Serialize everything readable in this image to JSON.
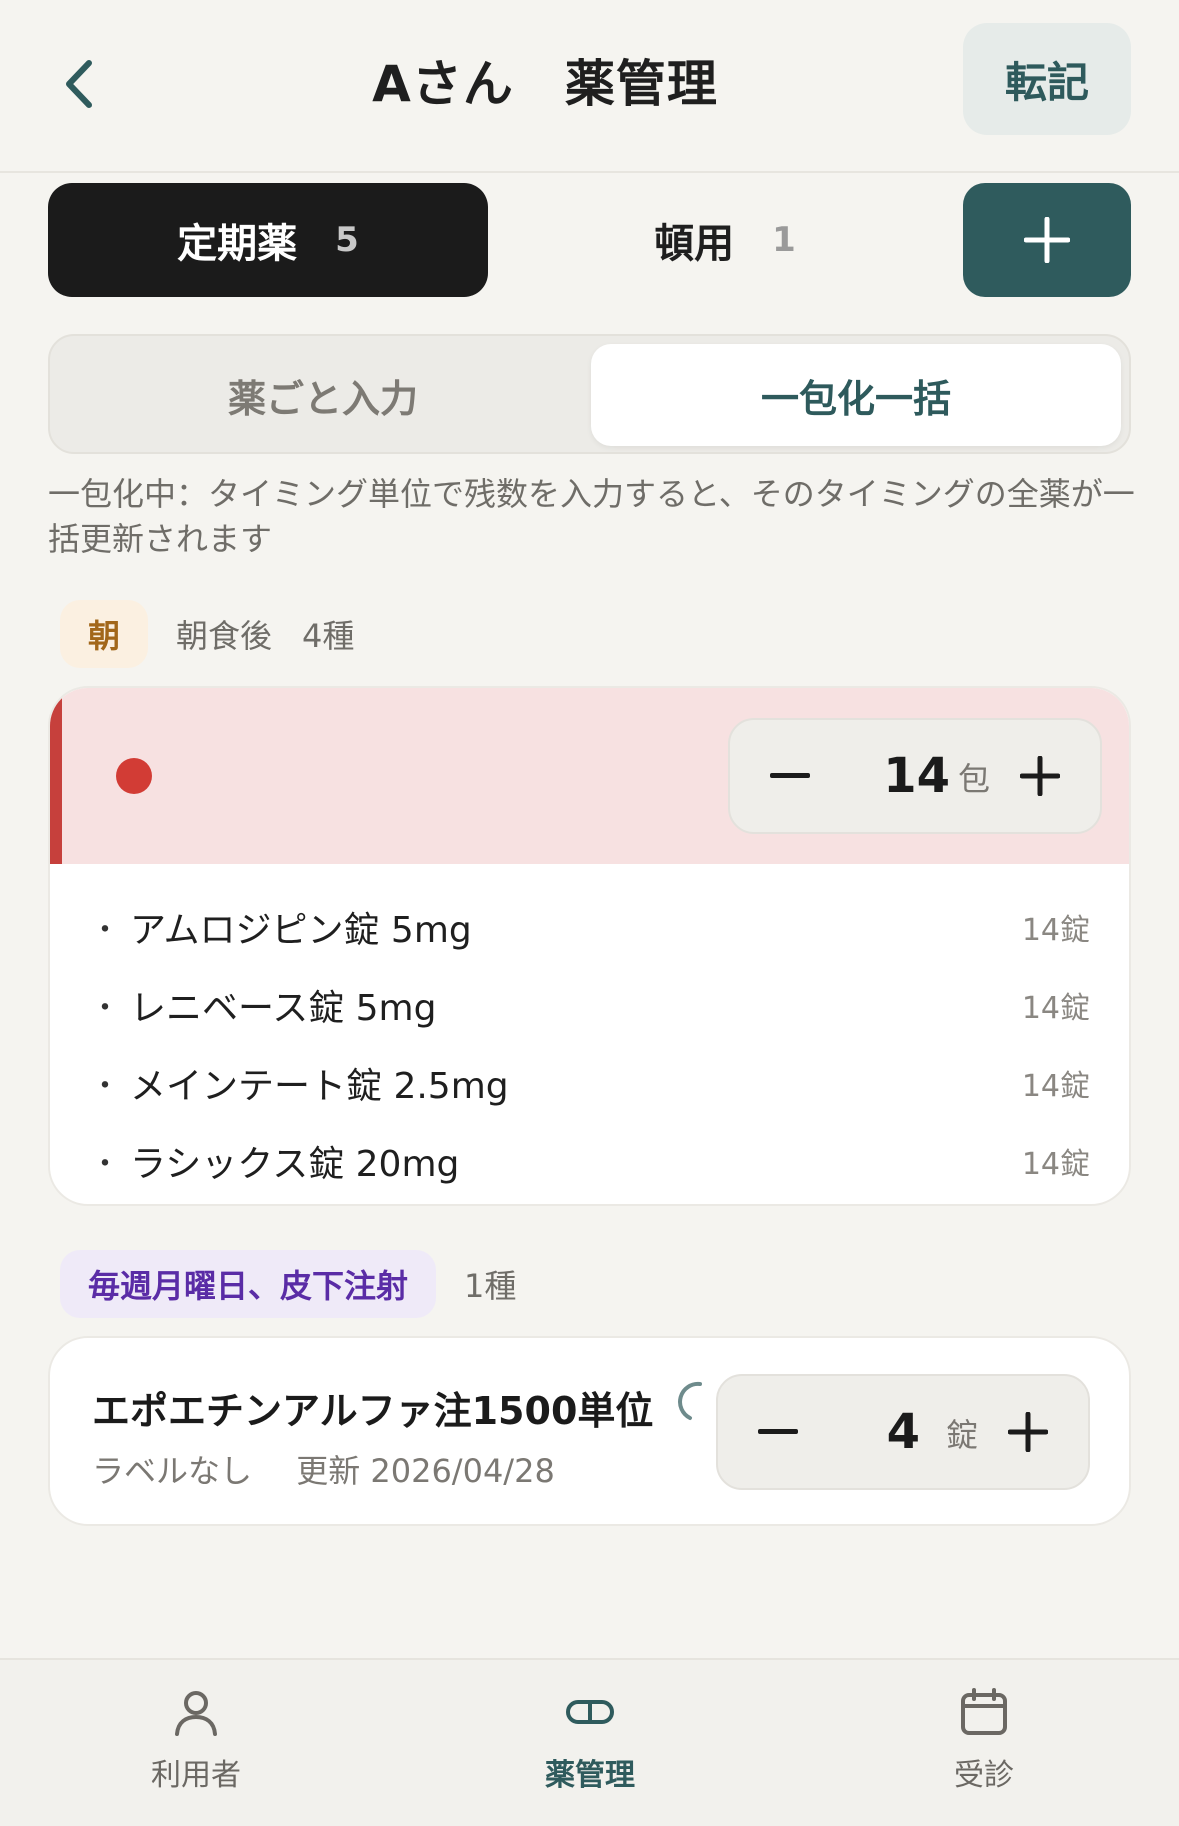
{
  "header": {
    "title": "Aさん　薬管理",
    "transcribe_label": "転記"
  },
  "category_tabs": [
    {
      "label": "定期薬",
      "count": "5",
      "active": true
    },
    {
      "label": "頓用",
      "count": "1",
      "active": false
    }
  ],
  "mode_segment": {
    "left_label": "薬ごと入力",
    "right_label": "一包化一括",
    "selected": "一包化一括"
  },
  "hint": "一包化中：タイミング単位で残数を入力すると、そのタイミングの全薬が一括更新されます",
  "groups": [
    {
      "chip": "朝",
      "timing": "朝食後",
      "kinds": "4種",
      "stepper": {
        "value": "14",
        "unit": "包"
      },
      "medications": [
        {
          "name": "アムロジピン錠 5mg",
          "qty": "14錠"
        },
        {
          "name": "レニベース錠 5mg",
          "qty": "14錠"
        },
        {
          "name": "メインテート錠 2.5mg",
          "qty": "14錠"
        },
        {
          "name": "ラシックス錠 20mg",
          "qty": "14錠"
        }
      ]
    },
    {
      "chip": "毎週月曜日、皮下注射",
      "kinds": "1種",
      "item": {
        "name": "エポエチンアルファ注1500単位",
        "label": "ラベルなし",
        "updated": "更新 2026/04/28",
        "stepper": {
          "value": "4",
          "unit": "錠"
        }
      }
    }
  ],
  "bottom_nav": [
    {
      "label": "利用者",
      "icon": "person-icon",
      "active": false
    },
    {
      "label": "薬管理",
      "icon": "pill-icon",
      "active": true
    },
    {
      "label": "受診",
      "icon": "calendar-icon",
      "active": false
    }
  ],
  "colors": {
    "accent": "#2f5b5d",
    "alert_red": "#d23c35",
    "alert_bg": "#f7e1e1",
    "morning_chip": "#a2671a",
    "weekly_chip": "#5a2ca6"
  }
}
